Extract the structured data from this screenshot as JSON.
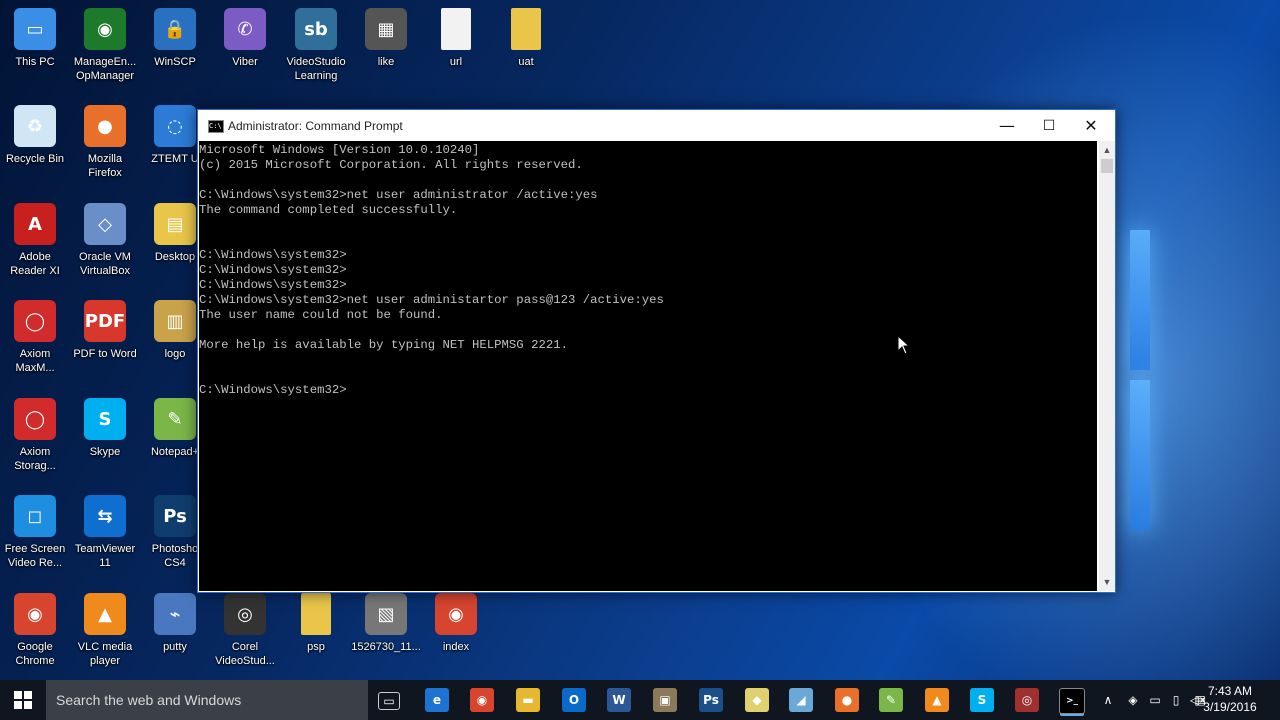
{
  "desktop": {
    "icons": [
      {
        "label": "This PC",
        "icon": "this-pc-icon"
      },
      {
        "label": "ManageEn... OpManager",
        "icon": "opmanager-icon"
      },
      {
        "label": "WinSCP",
        "icon": "winscp-icon"
      },
      {
        "label": "Viber",
        "icon": "viber-icon"
      },
      {
        "label": "VideoStudio Learning",
        "icon": "videostudio-icon"
      },
      {
        "label": "like",
        "icon": "image-file-icon"
      },
      {
        "label": "url",
        "icon": "text-file-icon"
      },
      {
        "label": "uat",
        "icon": "folder-icon"
      },
      {
        "label": "Recycle Bin",
        "icon": "recycle-bin-icon"
      },
      {
        "label": "Mozilla Firefox",
        "icon": "firefox-icon"
      },
      {
        "label": "ZTEMT U",
        "icon": "ztemt-icon"
      },
      {
        "label": "Adobe Reader XI",
        "icon": "adobe-reader-icon"
      },
      {
        "label": "Oracle VM VirtualBox",
        "icon": "virtualbox-icon"
      },
      {
        "label": "Desktop",
        "icon": "desktop-folder-icon"
      },
      {
        "label": "Axiom MaxM...",
        "icon": "axiom-icon"
      },
      {
        "label": "PDF to Word",
        "icon": "pdf-to-word-icon"
      },
      {
        "label": "logo",
        "icon": "logo-folder-icon"
      },
      {
        "label": "Axiom Storag...",
        "icon": "axiom-storage-icon"
      },
      {
        "label": "Skype",
        "icon": "skype-icon"
      },
      {
        "label": "Notepad+",
        "icon": "notepad-plus-icon"
      },
      {
        "label": "Free Screen Video Re...",
        "icon": "screen-recorder-icon"
      },
      {
        "label": "TeamViewer 11",
        "icon": "teamviewer-icon"
      },
      {
        "label": "Photosho CS4",
        "icon": "photoshop-icon"
      },
      {
        "label": "Google Chrome",
        "icon": "chrome-icon"
      },
      {
        "label": "VLC media player",
        "icon": "vlc-icon"
      },
      {
        "label": "putty",
        "icon": "putty-icon"
      },
      {
        "label": "Corel VideoStud...",
        "icon": "corel-icon"
      },
      {
        "label": "psp",
        "icon": "folder-icon"
      },
      {
        "label": "1526730_11...",
        "icon": "photo-icon"
      },
      {
        "label": "index",
        "icon": "chrome-icon"
      }
    ]
  },
  "window": {
    "title": "Administrator: Command Prompt",
    "icon_glyph": "C:\\",
    "minimize": "—",
    "maximize": "☐",
    "close": "✕",
    "console_lines": [
      "Microsoft Windows [Version 10.0.10240]",
      "(c) 2015 Microsoft Corporation. All rights reserved.",
      "",
      "C:\\Windows\\system32>net user administrator /active:yes",
      "The command completed successfully.",
      "",
      "",
      "C:\\Windows\\system32>",
      "C:\\Windows\\system32>",
      "C:\\Windows\\system32>",
      "C:\\Windows\\system32>net user administartor pass@123 /active:yes",
      "The user name could not be found.",
      "",
      "More help is available by typing NET HELPMSG 2221.",
      "",
      "",
      "C:\\Windows\\system32>"
    ]
  },
  "taskbar": {
    "search_placeholder": "Search the web and Windows",
    "pinned": [
      {
        "icon": "task-view-icon",
        "glyph": "▭",
        "color": "#0f1620"
      },
      {
        "icon": "edge-icon",
        "glyph": "e",
        "color": "#1e73d2"
      },
      {
        "icon": "chrome-icon",
        "glyph": "◉",
        "color": "#d8452f"
      },
      {
        "icon": "file-explorer-icon",
        "glyph": "▬",
        "color": "#e8b730"
      },
      {
        "icon": "outlook-icon",
        "glyph": "O",
        "color": "#0a6ac9"
      },
      {
        "icon": "word-icon",
        "glyph": "W",
        "color": "#2b5797"
      },
      {
        "icon": "screenshot-tool-icon",
        "glyph": "▣",
        "color": "#8a7a5a"
      },
      {
        "icon": "photoshop-icon",
        "glyph": "Ps",
        "color": "#1b4f8a"
      },
      {
        "icon": "notes-icon",
        "glyph": "◆",
        "color": "#e0d070"
      },
      {
        "icon": "pen-icon",
        "glyph": "◢",
        "color": "#6aa8d8"
      },
      {
        "icon": "firefox-icon",
        "glyph": "●",
        "color": "#e8702a"
      },
      {
        "icon": "notepad-plus-icon",
        "glyph": "✎",
        "color": "#7ab648"
      },
      {
        "icon": "vlc-icon",
        "glyph": "▲",
        "color": "#f08a1c"
      },
      {
        "icon": "skype-icon",
        "glyph": "S",
        "color": "#00aff0"
      },
      {
        "icon": "camera-icon",
        "glyph": "◎",
        "color": "#a03030"
      },
      {
        "icon": "command-prompt-icon",
        "glyph": ">_",
        "color": "#000000"
      }
    ],
    "tray": {
      "chevron": "∧",
      "glyphs": [
        "◈",
        "▭",
        "▯",
        "◁×",
        "▤"
      ]
    },
    "clock": {
      "time": "7:43 AM",
      "date": "3/19/2016"
    }
  }
}
